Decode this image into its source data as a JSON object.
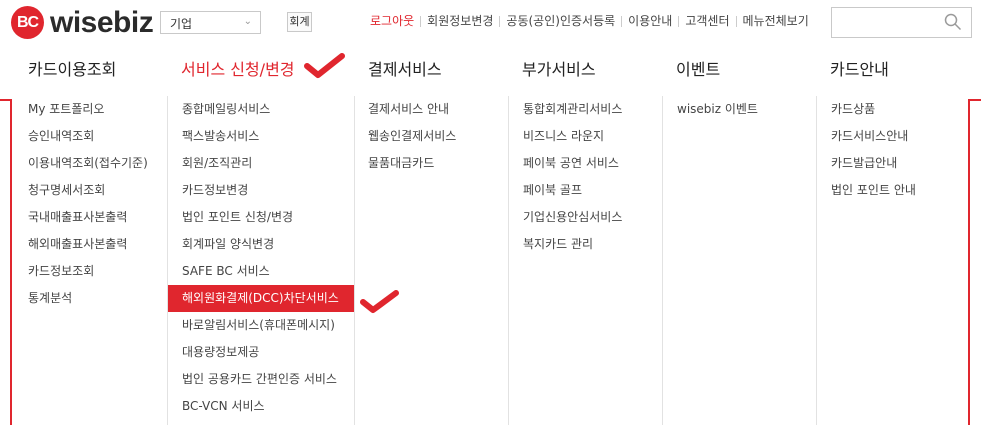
{
  "header": {
    "logo_mark": "BC",
    "logo_text": "wisebiz",
    "account_type": "기업",
    "search_button": "회계",
    "util_links": [
      "로그아웃",
      "회원정보변경",
      "공동(공인)인증서등록",
      "이용안내",
      "고객센터",
      "메뉴전체보기"
    ],
    "search_placeholder": ""
  },
  "colors": {
    "accent": "#e0262e",
    "text": "#333333",
    "divider": "#e2e2e2"
  },
  "gnb": [
    {
      "label": "카드이용조회",
      "active": false
    },
    {
      "label": "서비스 신청/변경",
      "active": true
    },
    {
      "label": "결제서비스",
      "active": false
    },
    {
      "label": "부가서비스",
      "active": false
    },
    {
      "label": "이벤트",
      "active": false
    },
    {
      "label": "카드안내",
      "active": false
    }
  ],
  "menu": {
    "card_usage": [
      "My 포트폴리오",
      "승인내역조회",
      "이용내역조회(접수기준)",
      "청구명세서조회",
      "국내매출표사본출력",
      "해외매출표사본출력",
      "카드정보조회",
      "통계분석"
    ],
    "service": [
      "종합메일링서비스",
      "팩스발송서비스",
      "회원/조직관리",
      "카드정보변경",
      "법인 포인트 신청/변경",
      "회계파일 양식변경",
      "SAFE BC 서비스",
      "해외원화결제(DCC)차단서비스",
      "바로알림서비스(휴대폰메시지)",
      "대용량정보제공",
      "법인 공용카드 간편인증 서비스",
      "BC-VCN 서비스"
    ],
    "payment": [
      "결제서비스 안내",
      "웹송인결제서비스",
      "물품대금카드"
    ],
    "extra": [
      "통합회계관리서비스",
      "비즈니스 라운지",
      "페이북 공연 서비스",
      "페이북 골프",
      "기업신용안심서비스",
      "복지카드 관리"
    ],
    "event": [
      "wisebiz 이벤트"
    ],
    "card_info": [
      "카드상품",
      "카드서비스안내",
      "카드발급안내",
      "법인 포인트 안내"
    ]
  },
  "highlighted_item": "해외원화결제(DCC)차단서비스",
  "icons": [
    "logo-icon",
    "chevron-down-icon",
    "search-icon",
    "checkmark-icon"
  ]
}
